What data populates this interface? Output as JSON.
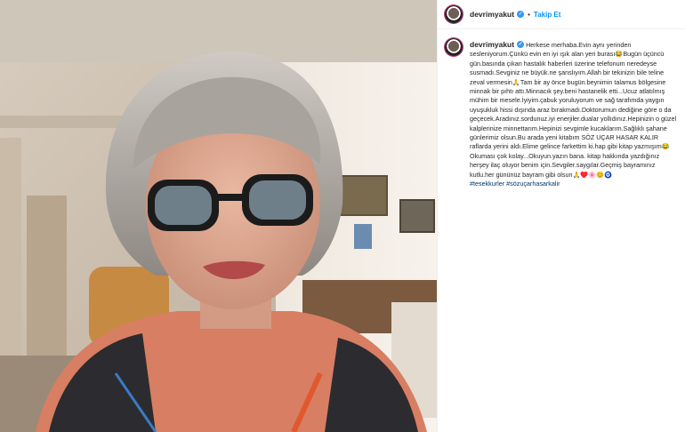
{
  "post": {
    "username": "devrimyakut",
    "separator": "•",
    "follow_label": "Takip Et",
    "caption": "Herkese merhaba.Evin aynı yerinden sesleniyorum.Çünkü evin en iyi ışık alan yeri burası😂Bugün üçüncü gün.basında çıkan hastalık haberleri üzerine telefonum neredeyse susmadı.Sevginiz ne büyük.ne şanslıyım.Allah bir tekinizin bile teline zeval vermesin🙏Tam bir ay önce bugün.beynimin talamus bölgesine minnak bir pıhtı attı.Minnacık şey.beni hastanelik etti...Ucuz atlatılmış mühim bir mesele.İyiyim.çabuk yoruluyorum ve sağ tarafımda yaygın uyuşukluk hissi dışında araz bırakmadı.Doktorumun dediğine göre o da geçecek.Aradınız.sordunuz.iyi enerjiler.dualar yollıdınız.Hepinizin o güzel kalplerinize minnettarım.Hepinizi sevgimle kucaklarım.Sağlıklı şahane günlerimiz olsun.Bu arada yeni kitabım SÖZ UÇAR HASAR KALIR raflarda yerini aldı.Elime gelince farkettim ki.hap gibi kitap yazmışım😂Okuması çok kolay...Okuyun.yazın bana. kitap hakkında yazdığınız herşey ilaç oluyor benim için.Sevgiler.saygılar.Geçmiş bayramınız kutlu.her gününüz bayram gibi olsun🙏♥️🌸😊🧿",
    "hashtags": [
      "#tesekkurler",
      "#sözuçarhasarkalir"
    ]
  },
  "icons": {
    "avatar": "profile-avatar",
    "verified": "verified-badge-icon"
  },
  "colors": {
    "accent": "#0095f6",
    "verified": "#3897f0",
    "hashtag": "#00376b",
    "text": "#262626"
  }
}
